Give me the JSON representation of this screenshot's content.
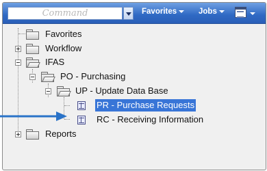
{
  "toolbar": {
    "command_placeholder": "Command",
    "favorites_label": "Favorites",
    "jobs_label": "Jobs",
    "accent_color": "#2f69c4"
  },
  "tree": {
    "favorites": "Favorites",
    "workflow": "Workflow",
    "ifas": "IFAS",
    "po": "PO - Purchasing",
    "up": "UP - Update Data Base",
    "pr": "PR - Purchase Requests",
    "rc": "RC - Receiving Information",
    "reports": "Reports",
    "selected_color": "#3875d7"
  },
  "icons": {
    "folder": "folder-icon",
    "folder_open": "folder-open-icon",
    "form": "form-icon",
    "pointer": "pointer-arrow-icon"
  }
}
